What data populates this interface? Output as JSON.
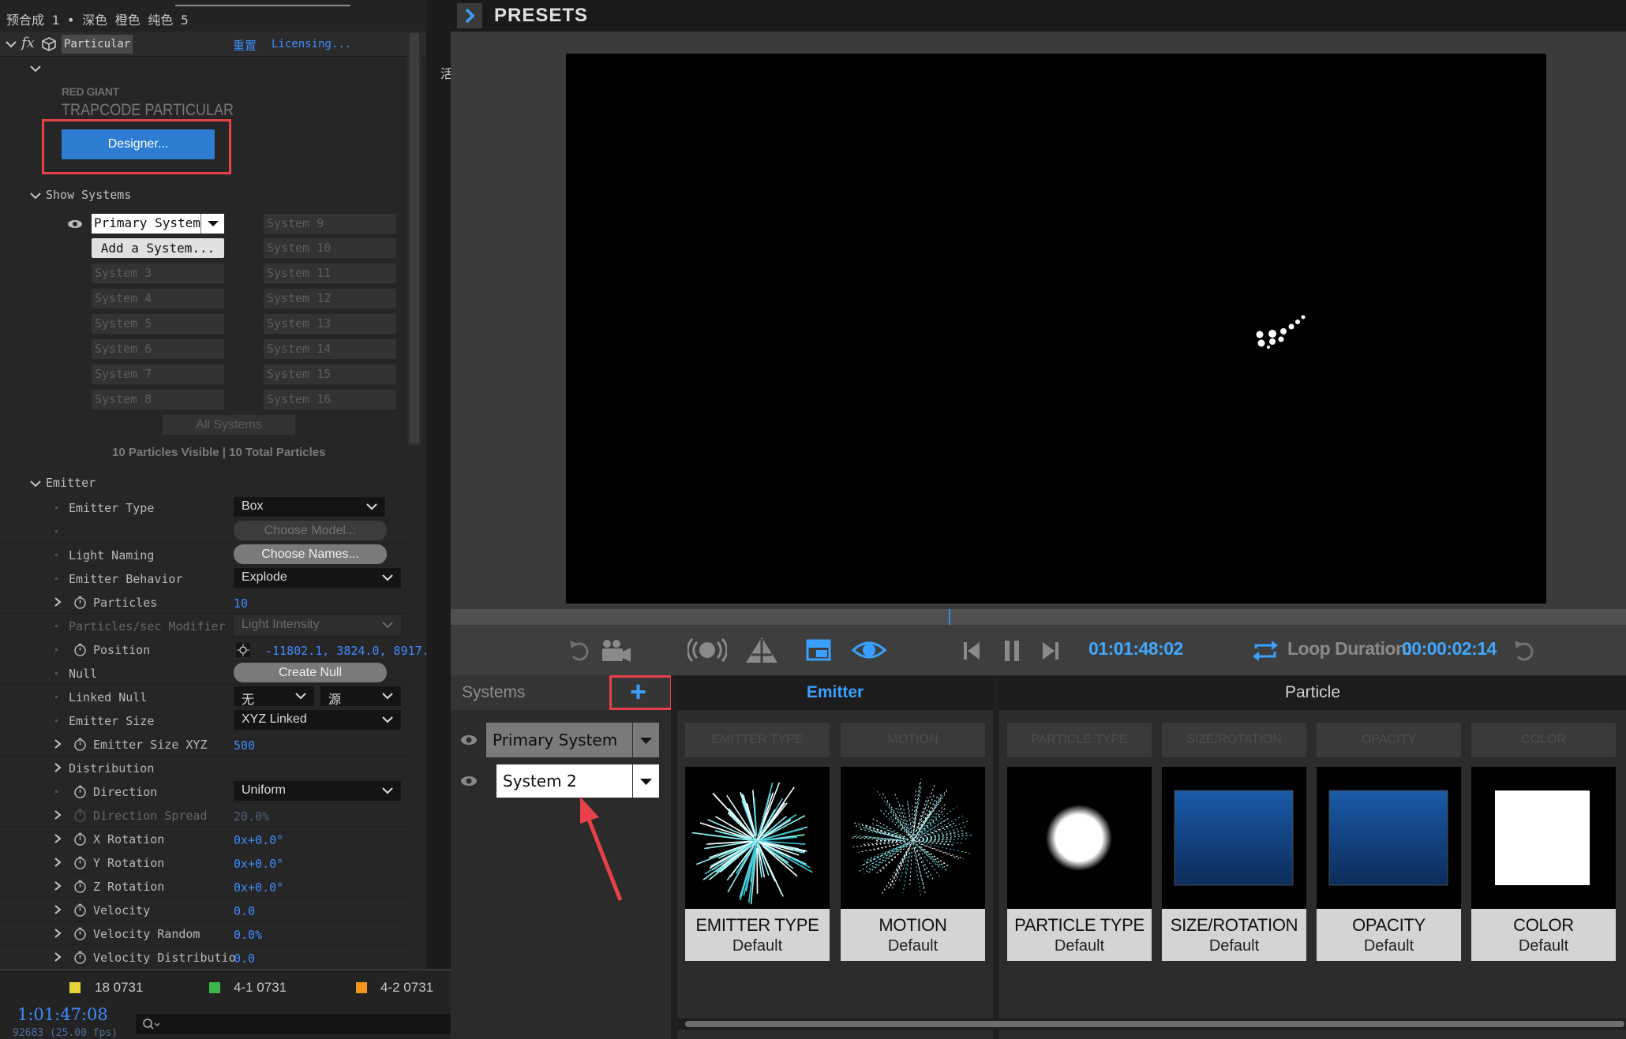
{
  "left_panel": {
    "title": "预合成 1 • 深色 橙色 纯色 5",
    "effect": {
      "name": "Particular",
      "reset_label": "重置",
      "licensing_label": "Licensing..."
    },
    "logo": {
      "maker": "RED GIANT",
      "product": "TRAPCODE PARTICULAR"
    },
    "designer_button": "Designer...",
    "show_systems": {
      "label": "Show Systems",
      "primary_system": "Primary System",
      "add_system": "Add a System...",
      "col1": [
        "System 3",
        "System 4",
        "System 5",
        "System 6",
        "System 7",
        "System 8"
      ],
      "col2": [
        "System 9",
        "System 10",
        "System 11",
        "System 12",
        "System 13",
        "System 14",
        "System 15",
        "System 16"
      ],
      "all_systems": "All Systems",
      "particle_counts": "10 Particles Visible  |  10 Total Particles"
    },
    "emitter": {
      "label": "Emitter",
      "emitter_type": {
        "label": "Emitter Type",
        "value": "Box"
      },
      "choose_model": "Choose Model...",
      "light_naming": {
        "label": "Light Naming",
        "button": "Choose Names..."
      },
      "emitter_behavior": {
        "label": "Emitter Behavior",
        "value": "Explode"
      },
      "particles": {
        "label": "Particles",
        "value": "10"
      },
      "particles_sec_modifier": {
        "label": "Particles/sec Modifier",
        "value": "Light Intensity"
      },
      "position": {
        "label": "Position",
        "value": "-11802.1, 3824.0, 8917."
      },
      "null": {
        "label": "Null",
        "button": "Create Null"
      },
      "linked_null": {
        "label": "Linked Null",
        "value1": "无",
        "value2": "源"
      },
      "emitter_size": {
        "label": "Emitter Size",
        "value": "XYZ Linked"
      },
      "emitter_size_xyz": {
        "label": "Emitter Size XYZ",
        "value": "500"
      },
      "distribution": {
        "label": "Distribution"
      },
      "direction": {
        "label": "Direction",
        "value": "Uniform"
      },
      "direction_spread": {
        "label": "Direction Spread",
        "value": "20.0%"
      },
      "x_rotation": {
        "label": "X Rotation",
        "value": "0x+0.0°"
      },
      "y_rotation": {
        "label": "Y Rotation",
        "value": "0x+0.0°"
      },
      "z_rotation": {
        "label": "Z Rotation",
        "value": "0x+0.0°"
      },
      "velocity": {
        "label": "Velocity",
        "value": "0.0"
      },
      "velocity_random": {
        "label": "Velocity Random",
        "value": "0.0%"
      },
      "velocity_distribution": {
        "label": "Velocity Distributio",
        "value": "0.0"
      }
    },
    "timeline_legend": [
      {
        "label": "18 0731",
        "color": "#e8d23c"
      },
      {
        "label": "4-1 0731",
        "color": "#3db54a"
      },
      {
        "label": "4-2 0731",
        "color": "#f0961e"
      }
    ],
    "timecode": "1:01:47:08",
    "fps": "92683 (25.00 fps)",
    "strip_char": "活"
  },
  "designer": {
    "presets_title": "PRESETS",
    "transport": {
      "time": "01:01:48:02",
      "loop_label": "Loop Duration:",
      "loop_value": "00:00:02:14"
    },
    "systems": {
      "title": "Systems",
      "add_icon": "plus-icon",
      "primary": "Primary System",
      "system2": "System 2"
    },
    "emitter_header": "Emitter",
    "particle_header": "Particle",
    "emitter_cards": [
      {
        "tab": "EMITTER TYPE",
        "title": "EMITTER TYPE",
        "sub": "Default"
      },
      {
        "tab": "MOTION",
        "title": "MOTION",
        "sub": "Default"
      }
    ],
    "particle_cards": [
      {
        "tab": "PARTICLE TYPE",
        "title": "PARTICLE TYPE",
        "sub": "Default"
      },
      {
        "tab": "SIZE/ROTATION",
        "title": "SIZE/ROTATION",
        "sub": "Default"
      },
      {
        "tab": "OPACITY",
        "title": "OPACITY",
        "sub": "Default"
      },
      {
        "tab": "COLOR",
        "title": "COLOR",
        "sub": "Default"
      }
    ],
    "colors": {
      "accent": "#3fa8ff",
      "highlight": "#e8414a",
      "designer_button": "#2d7dd2"
    }
  }
}
